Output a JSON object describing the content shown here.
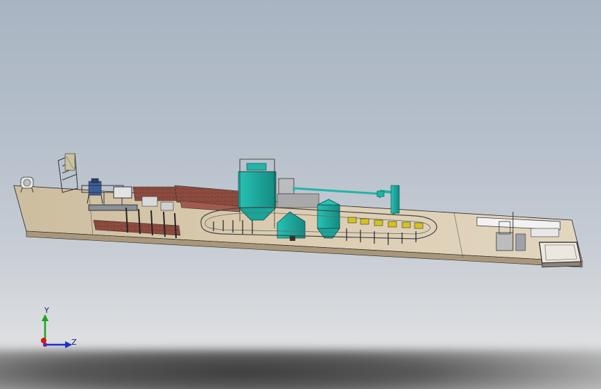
{
  "viewport": {
    "axis_labels": {
      "y": "Y",
      "z": "Z"
    }
  },
  "colors": {
    "floor": "#d9c9ac",
    "brick": "#8a4a3e",
    "teal": "#1fb5a8",
    "teal_dark": "#127a72",
    "steel": "#5a5e66",
    "axis_y": "#1aa31a",
    "axis_z": "#1a2fd0",
    "axis_x": "#d01a1a"
  },
  "icons": {
    "triad": "coordinate-triad-icon"
  }
}
